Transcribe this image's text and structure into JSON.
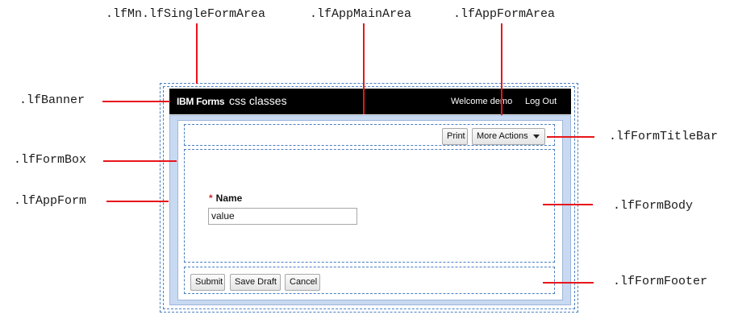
{
  "callouts": {
    "single_form_area": ".lfMn.lfSingleFormArea",
    "app_main_area": ".lfAppMainArea",
    "app_form_area": ".lfAppFormArea",
    "banner": ".lfBanner",
    "form_box": ".lfFormBox",
    "app_form": ".lfAppForm",
    "form_title_bar": ".lfFormTitleBar",
    "form_body": ".lfFormBody",
    "form_footer": ".lfFormFooter"
  },
  "banner": {
    "brand": "IBM Forms",
    "app_title": "css classes",
    "welcome": "Welcome demo",
    "logout": "Log Out"
  },
  "title_bar": {
    "print_label": "Print",
    "more_actions_label": "More Actions"
  },
  "form": {
    "required_marker": "*",
    "name_label": "Name",
    "name_value": "value"
  },
  "footer": {
    "submit_label": "Submit",
    "save_draft_label": "Save Draft",
    "cancel_label": "Cancel"
  },
  "colors": {
    "leader": "#e8151b",
    "dashed_border": "#4a7fc1",
    "app_form_fill": "#c9d9f1",
    "banner_bg": "#000000"
  }
}
